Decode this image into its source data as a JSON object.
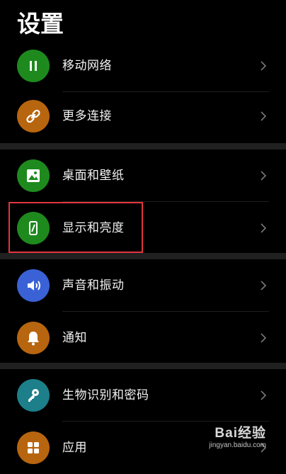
{
  "page": {
    "title": "设置"
  },
  "rows": [
    {
      "label": "移动网络",
      "icon": "mobile-network-icon",
      "color": "#1e8a1e"
    },
    {
      "label": "更多连接",
      "icon": "link-icon",
      "color": "#b7650f"
    },
    {
      "label": "桌面和壁纸",
      "icon": "wallpaper-icon",
      "color": "#1e8a1e"
    },
    {
      "label": "显示和亮度",
      "icon": "display-brightness-icon",
      "color": "#1e8a1e"
    },
    {
      "label": "声音和振动",
      "icon": "speaker-icon",
      "color": "#3a62d6"
    },
    {
      "label": "通知",
      "icon": "bell-icon",
      "color": "#b7650f"
    },
    {
      "label": "生物识别和密码",
      "icon": "key-icon",
      "color": "#1c7f8a"
    },
    {
      "label": "应用",
      "icon": "apps-grid-icon",
      "color": "#b7650f"
    }
  ],
  "colors": {
    "background": "#000000",
    "group_gap": "#202020",
    "highlight": "#e3353e"
  },
  "watermark": {
    "main": "Bai经验",
    "sub": "jingyan.baidu.com"
  }
}
